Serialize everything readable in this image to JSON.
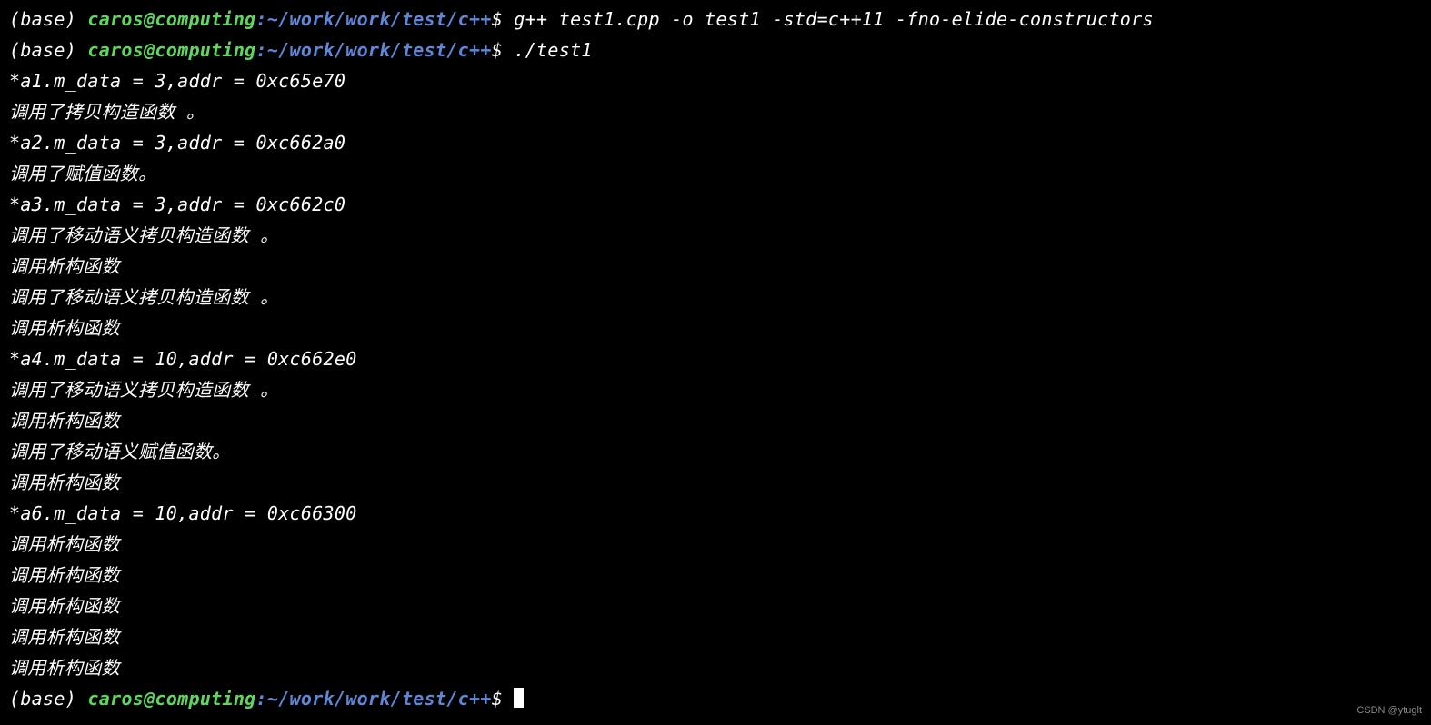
{
  "prompt": {
    "env": "(base) ",
    "user": "caros@computing",
    "path": ":~/work/work/test/c++",
    "dollar": "$"
  },
  "commands": {
    "compile": " g++ test1.cpp -o test1 -std=c++11 -fno-elide-constructors",
    "run": " ./test1"
  },
  "output": [
    "*a1.m_data = 3,addr = 0xc65e70",
    "调用了拷贝构造函数 。",
    "*a2.m_data = 3,addr = 0xc662a0",
    "调用了赋值函数。",
    "*a3.m_data = 3,addr = 0xc662c0",
    "调用了移动语义拷贝构造函数 。",
    "调用析构函数",
    "调用了移动语义拷贝构造函数 。",
    "调用析构函数",
    "*a4.m_data = 10,addr = 0xc662e0",
    "调用了移动语义拷贝构造函数 。",
    "调用析构函数",
    "调用了移动语义赋值函数。",
    "调用析构函数",
    "*a6.m_data = 10,addr = 0xc66300",
    "调用析构函数",
    "调用析构函数",
    "调用析构函数",
    "调用析构函数",
    "调用析构函数"
  ],
  "watermark": "CSDN @ytuglt"
}
